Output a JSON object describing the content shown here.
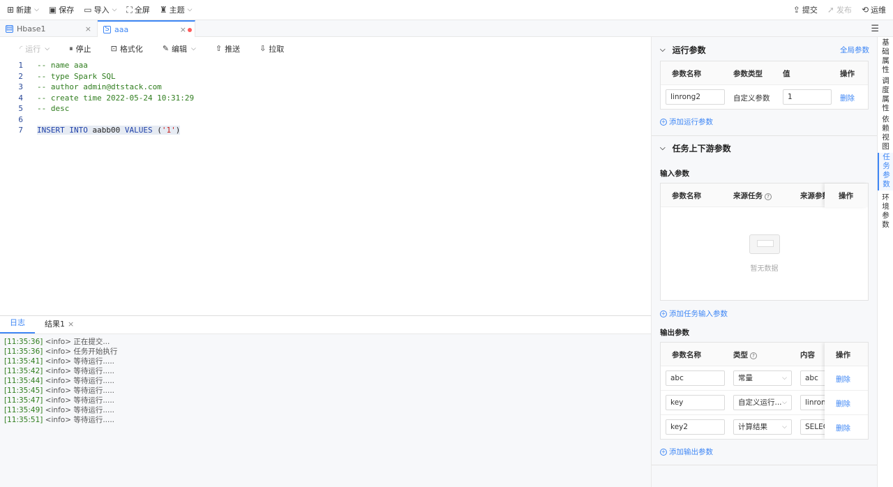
{
  "topbar": {
    "new_label": "新建",
    "save_label": "保存",
    "import_label": "导入",
    "fullscreen_label": "全屏",
    "theme_label": "主题",
    "submit_label": "提交",
    "publish_label": "发布",
    "ops_label": "运维"
  },
  "tabs": [
    {
      "label": "Hbase1"
    },
    {
      "label": "aaa"
    }
  ],
  "editor": {
    "toolbar": {
      "run": "运行",
      "stop": "停止",
      "format": "格式化",
      "edit": "编辑",
      "push": "推送",
      "pull": "拉取"
    },
    "lines": [
      {
        "n": "1",
        "text": "-- name aaa"
      },
      {
        "n": "2",
        "text": "-- type Spark SQL"
      },
      {
        "n": "3",
        "text": "-- author admin@dtstack.com"
      },
      {
        "n": "4",
        "text": "-- create time 2022-05-24 10:31:29"
      },
      {
        "n": "5",
        "text": "-- desc"
      },
      {
        "n": "6",
        "text": ""
      },
      {
        "n": "7",
        "kw1": "INSERT INTO",
        "tbl": "aabb00",
        "kw2": "VALUES",
        "p1": "(",
        "str": "'1'",
        "p2": ")"
      }
    ]
  },
  "bottom": {
    "tab_log": "日志",
    "tab_result": "结果1",
    "logs": [
      {
        "ts": "[11:35:36]",
        "msg": "<info> 正在提交..."
      },
      {
        "ts": "[11:35:36]",
        "msg": "<info> 任务开始执行"
      },
      {
        "ts": "[11:35:41]",
        "msg": "<info> 等待运行....."
      },
      {
        "ts": "[11:35:42]",
        "msg": "<info> 等待运行....."
      },
      {
        "ts": "[11:35:44]",
        "msg": "<info> 等待运行....."
      },
      {
        "ts": "[11:35:45]",
        "msg": "<info> 等待运行....."
      },
      {
        "ts": "[11:35:47]",
        "msg": "<info> 等待运行....."
      },
      {
        "ts": "[11:35:49]",
        "msg": "<info> 等待运行....."
      },
      {
        "ts": "[11:35:51]",
        "msg": "<info> 等待运行....."
      }
    ]
  },
  "run_params": {
    "title": "运行参数",
    "global_link": "全局参数",
    "cols": {
      "name": "参数名称",
      "type": "参数类型",
      "value": "值",
      "op": "操作"
    },
    "row": {
      "name": "linrong2",
      "type": "自定义参数",
      "value": "1",
      "del": "删除"
    },
    "add": "添加运行参数"
  },
  "task_params": {
    "title": "任务上下游参数",
    "input_title": "输入参数",
    "input_cols": {
      "name": "参数名称",
      "source_task": "来源任务",
      "source_param": "来源参数",
      "op": "操作"
    },
    "empty": "暂无数据",
    "add_input": "添加任务输入参数",
    "output_title": "输出参数",
    "output_cols": {
      "name": "参数名称",
      "type": "类型",
      "content": "内容",
      "op": "操作"
    },
    "output_rows": [
      {
        "name": "abc",
        "type": "常量",
        "content": "abc",
        "del": "删除"
      },
      {
        "name": "key",
        "type": "自定义运行...",
        "content": "linrong",
        "del": "删除"
      },
      {
        "name": "key2",
        "type": "计算结果",
        "content": "SELEC",
        "del": "删除"
      }
    ],
    "add_output": "添加输出参数"
  },
  "side_tabs": [
    {
      "label": "基础属性"
    },
    {
      "label": "调度属性"
    },
    {
      "label": "依赖视图"
    },
    {
      "label": "任务参数"
    },
    {
      "label": "环境参数"
    }
  ]
}
